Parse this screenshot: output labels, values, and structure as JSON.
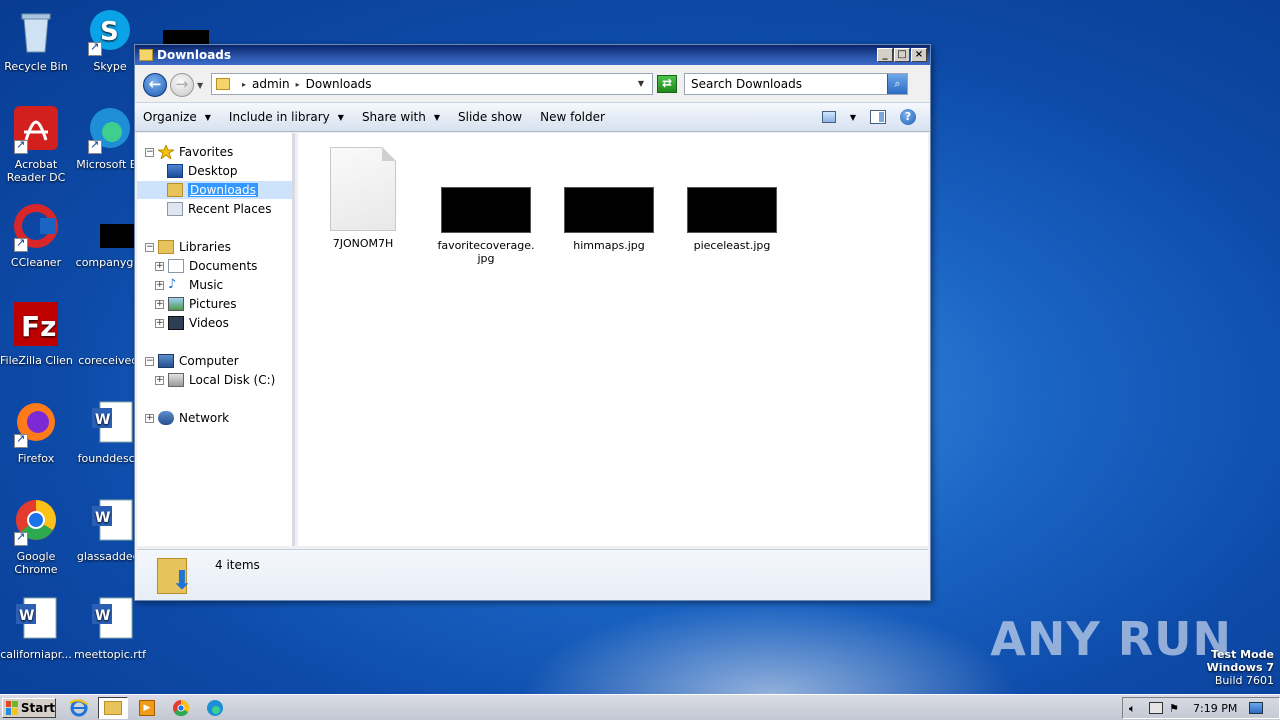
{
  "desktop": {
    "icons": [
      {
        "label": "Recycle Bin",
        "icon": "recycle-bin-icon"
      },
      {
        "label": "Skype",
        "icon": "skype-icon"
      },
      {
        "label": "Acrobat Reader DC",
        "label_l1": "Acrobat",
        "label_l2": "Reader DC",
        "icon": "acrobat-icon"
      },
      {
        "label": "Microsoft Ed",
        "icon": "edge-icon"
      },
      {
        "label": "CCleaner",
        "icon": "ccleaner-icon"
      },
      {
        "label": "companygro",
        "icon": "file-icon"
      },
      {
        "label": "FileZilla Client",
        "icon": "filezilla-icon"
      },
      {
        "label": "coreceived.",
        "icon": "file-icon"
      },
      {
        "label": "Firefox",
        "icon": "firefox-icon"
      },
      {
        "label": "founddescri",
        "icon": "word-doc-icon"
      },
      {
        "label": "Google Chrome",
        "label_l1": "Google",
        "label_l2": "Chrome",
        "icon": "chrome-icon"
      },
      {
        "label": "glassadded.",
        "icon": "word-doc-icon"
      },
      {
        "label": "californiapr...",
        "icon": "word-doc-icon"
      },
      {
        "label": "meettopic.rtf",
        "icon": "word-doc-icon"
      }
    ]
  },
  "window": {
    "title": "Downloads",
    "address": {
      "segments": [
        "admin",
        "Downloads"
      ]
    },
    "search": {
      "placeholder": "Search Downloads"
    },
    "toolbar": {
      "organize": "Organize",
      "include": "Include in library",
      "share": "Share with",
      "slideshow": "Slide show",
      "newfolder": "New folder"
    },
    "nav": {
      "favorites": "Favorites",
      "desktop": "Desktop",
      "downloads": "Downloads",
      "recent": "Recent Places",
      "libraries": "Libraries",
      "documents": "Documents",
      "music": "Music",
      "pictures": "Pictures",
      "videos": "Videos",
      "computer": "Computer",
      "localdisk": "Local Disk (C:)",
      "network": "Network"
    },
    "files": [
      {
        "name": "7JONOM7H",
        "type": "blank"
      },
      {
        "name": "favoritecoverage.jpg",
        "type": "image"
      },
      {
        "name": "himmaps.jpg",
        "type": "image"
      },
      {
        "name": "pieceleast.jpg",
        "type": "image"
      }
    ],
    "status": {
      "count": "4 items"
    }
  },
  "taskbar": {
    "start": "Start",
    "clock": "7:19 PM"
  },
  "watermark": {
    "text": "ANY RUN"
  },
  "system": {
    "line1": "Test Mode",
    "line2": "Windows 7",
    "line3": "Build 7601"
  },
  "colors": {
    "accent": "#3399ff",
    "titlebar": "#0a246a",
    "desktop": "#1a64c4"
  }
}
